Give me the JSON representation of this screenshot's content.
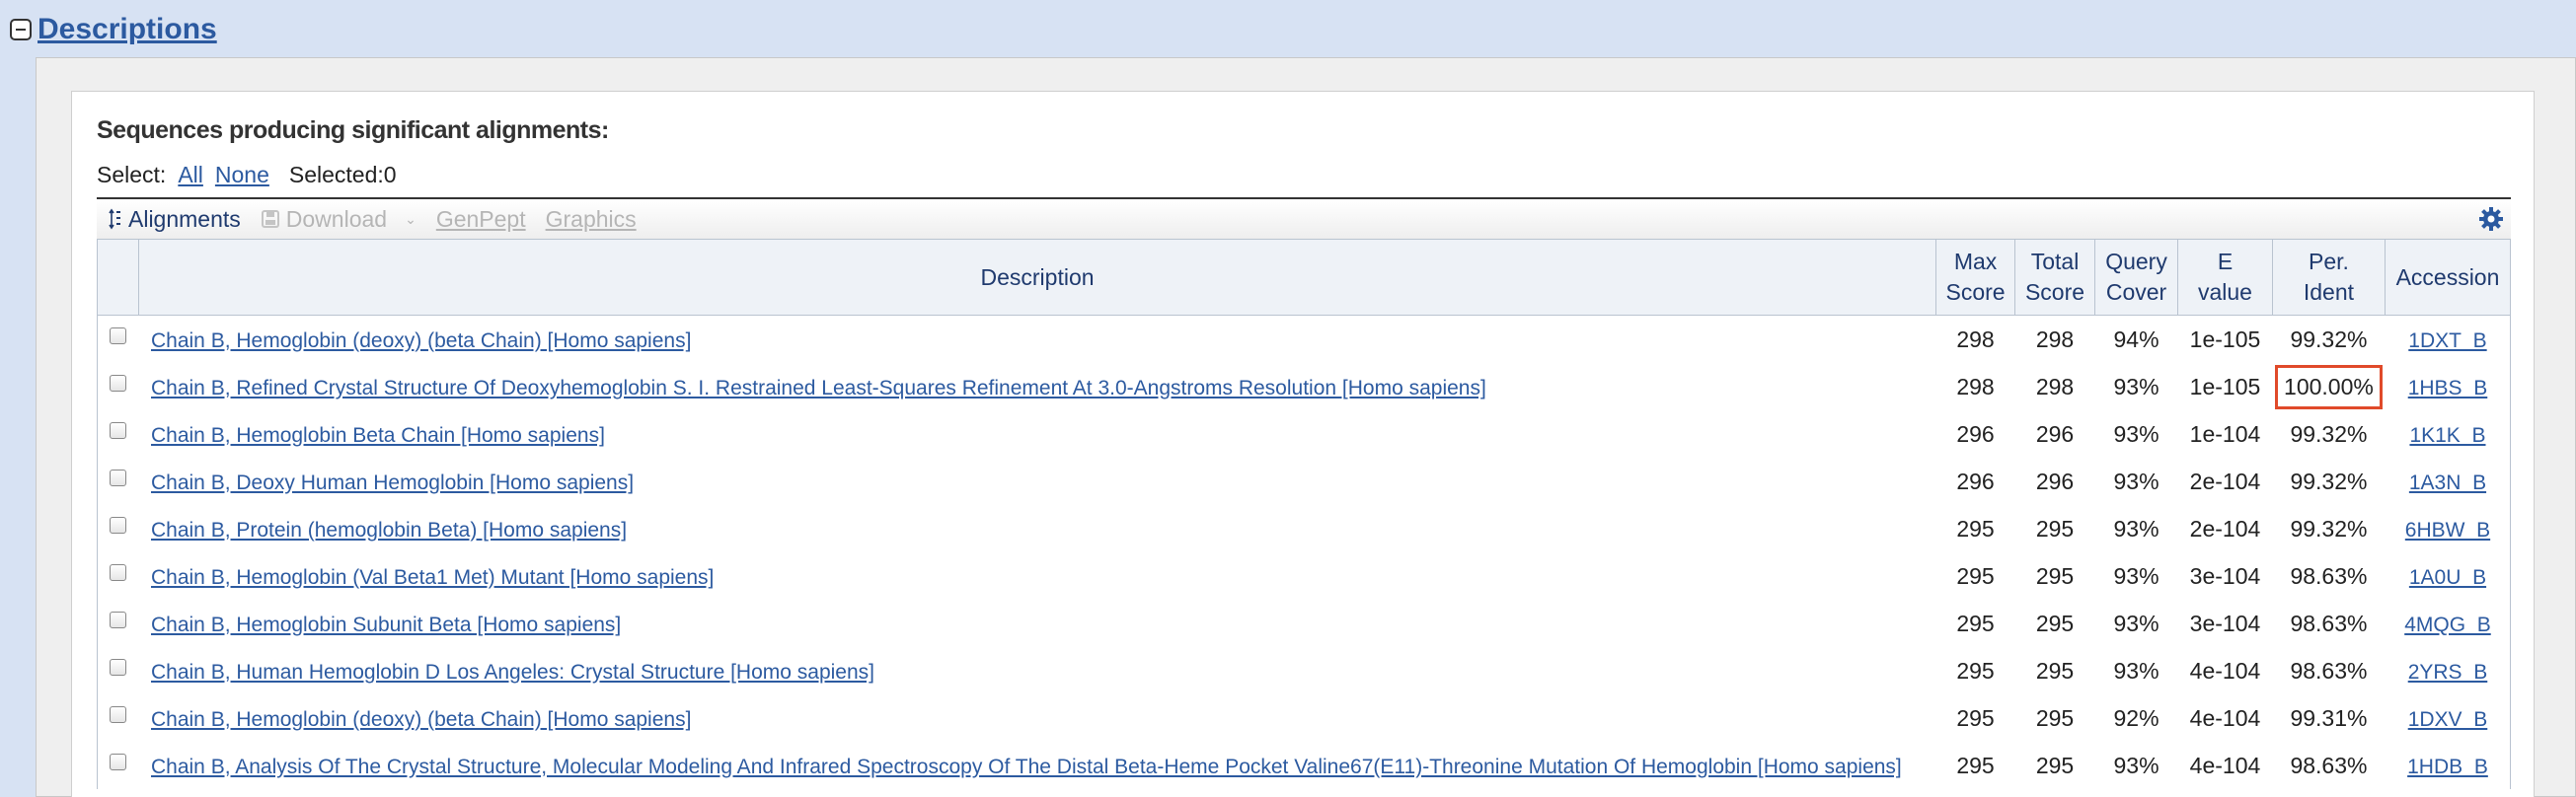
{
  "section": {
    "title": "Descriptions"
  },
  "heading": "Sequences producing significant alignments:",
  "select": {
    "label": "Select:",
    "all": "All",
    "none": "None",
    "selected": "Selected:0"
  },
  "toolbar": {
    "alignments": "Alignments",
    "download": "Download",
    "genpept": "GenPept",
    "graphics": "Graphics"
  },
  "table": {
    "headers": {
      "description": "Description",
      "max_score": [
        "Max",
        "Score"
      ],
      "total_score": [
        "Total",
        "Score"
      ],
      "query_cover": [
        "Query",
        "Cover"
      ],
      "e_value": [
        "E",
        "value"
      ],
      "per_ident": [
        "Per.",
        "Ident"
      ],
      "accession": "Accession"
    },
    "rows": [
      {
        "description": "Chain B, Hemoglobin (deoxy) (beta Chain) [Homo sapiens]",
        "max_score": "298",
        "total_score": "298",
        "query_cover": "94%",
        "e_value": "1e-105",
        "per_ident": "99.32%",
        "accession": "1DXT_B"
      },
      {
        "description": "Chain B, Refined Crystal Structure Of Deoxyhemoglobin S. I. Restrained Least-Squares Refinement At 3.0-Angstroms Resolution [Homo sapiens]",
        "max_score": "298",
        "total_score": "298",
        "query_cover": "93%",
        "e_value": "1e-105",
        "per_ident": "100.00%",
        "accession": "1HBS_B",
        "highlight": true
      },
      {
        "description": "Chain B, Hemoglobin Beta Chain [Homo sapiens]",
        "max_score": "296",
        "total_score": "296",
        "query_cover": "93%",
        "e_value": "1e-104",
        "per_ident": "99.32%",
        "accession": "1K1K_B"
      },
      {
        "description": "Chain B, Deoxy Human Hemoglobin [Homo sapiens]",
        "max_score": "296",
        "total_score": "296",
        "query_cover": "93%",
        "e_value": "2e-104",
        "per_ident": "99.32%",
        "accession": "1A3N_B"
      },
      {
        "description": "Chain B, Protein (hemoglobin Beta) [Homo sapiens]",
        "max_score": "295",
        "total_score": "295",
        "query_cover": "93%",
        "e_value": "2e-104",
        "per_ident": "99.32%",
        "accession": "6HBW_B"
      },
      {
        "description": "Chain B, Hemoglobin (Val Beta1 Met) Mutant [Homo sapiens]",
        "max_score": "295",
        "total_score": "295",
        "query_cover": "93%",
        "e_value": "3e-104",
        "per_ident": "98.63%",
        "accession": "1A0U_B"
      },
      {
        "description": "Chain B, Hemoglobin Subunit Beta [Homo sapiens]",
        "max_score": "295",
        "total_score": "295",
        "query_cover": "93%",
        "e_value": "3e-104",
        "per_ident": "98.63%",
        "accession": "4MQG_B"
      },
      {
        "description": "Chain B, Human Hemoglobin D Los Angeles: Crystal Structure [Homo sapiens]",
        "max_score": "295",
        "total_score": "295",
        "query_cover": "93%",
        "e_value": "4e-104",
        "per_ident": "98.63%",
        "accession": "2YRS_B"
      },
      {
        "description": "Chain B, Hemoglobin (deoxy) (beta Chain) [Homo sapiens]",
        "max_score": "295",
        "total_score": "295",
        "query_cover": "92%",
        "e_value": "4e-104",
        "per_ident": "99.31%",
        "accession": "1DXV_B"
      },
      {
        "description": "Chain B, Analysis Of The Crystal Structure, Molecular Modeling And Infrared Spectroscopy Of The Distal Beta-Heme Pocket Valine67(E11)-Threonine Mutation Of Hemoglobin [Homo sapiens]",
        "max_score": "295",
        "total_score": "295",
        "query_cover": "93%",
        "e_value": "4e-104",
        "per_ident": "98.63%",
        "accession": "1HDB_B"
      }
    ]
  },
  "colors": {
    "highlight": "#e04a2a",
    "link": "#2c5aa0",
    "background": "#d7e2f3"
  },
  "icons": [
    "collapse-icon",
    "alignments-icon",
    "download-icon",
    "dropdown-icon",
    "gear-icon"
  ]
}
